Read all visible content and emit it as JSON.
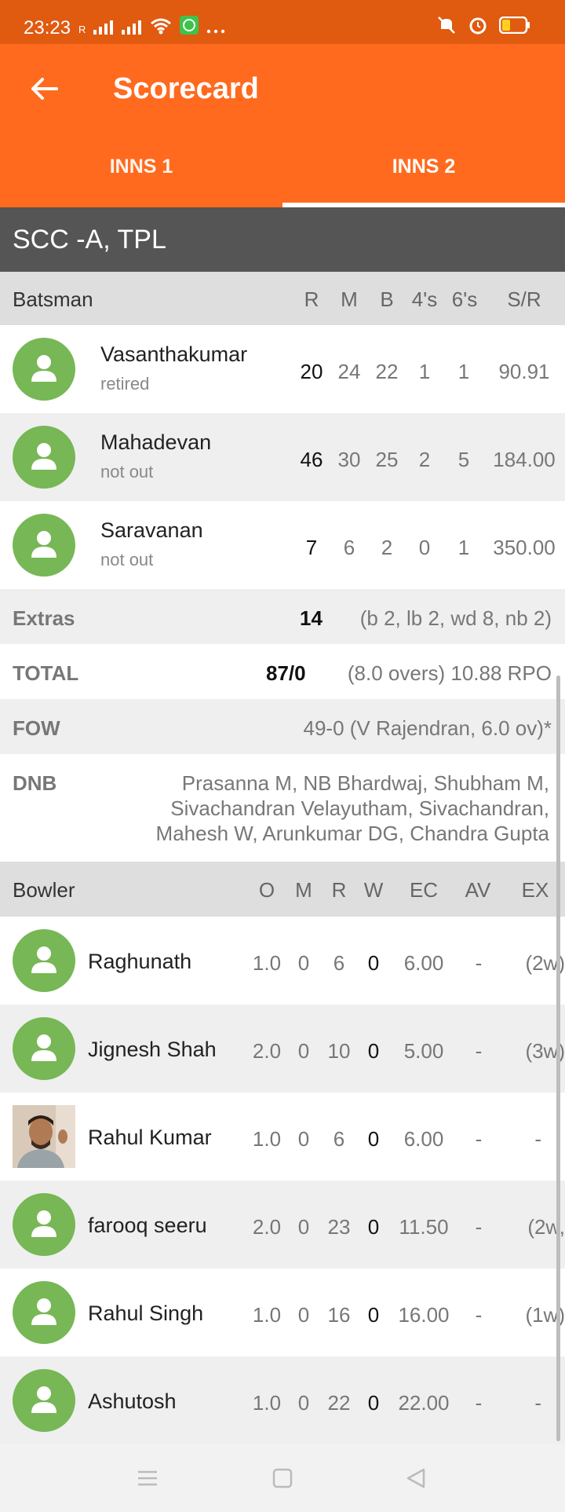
{
  "status_bar": {
    "time": "23:23",
    "signal_label": "R"
  },
  "header": {
    "title": "Scorecard",
    "back_icon": "arrow-left-icon"
  },
  "tabs": [
    {
      "label": "INNS 1"
    },
    {
      "label": "INNS 2"
    }
  ],
  "team": "SCC -A, TPL",
  "batting": {
    "columns": [
      "Batsman",
      "R",
      "M",
      "B",
      "4's",
      "6's",
      "S/R"
    ],
    "rows": [
      {
        "name": "Vasanthakumar",
        "status": "retired",
        "R": "20",
        "M": "24",
        "B": "22",
        "fours": "1",
        "sixes": "1",
        "SR": "90.91"
      },
      {
        "name": "Mahadevan",
        "status": "not out",
        "R": "46",
        "M": "30",
        "B": "25",
        "fours": "2",
        "sixes": "5",
        "SR": "184.00"
      },
      {
        "name": "Saravanan",
        "status": "not out",
        "R": "7",
        "M": "6",
        "B": "2",
        "fours": "0",
        "sixes": "1",
        "SR": "350.00"
      }
    ]
  },
  "extras": {
    "label": "Extras",
    "value": "14",
    "detail": "(b 2, lb 2, wd 8, nb 2)"
  },
  "total": {
    "label": "TOTAL",
    "value": "87/0",
    "detail": "(8.0 overs) 10.88 RPO"
  },
  "fow": {
    "label": "FOW",
    "detail": "49-0 (V Rajendran, 6.0 ov)*"
  },
  "dnb": {
    "label": "DNB",
    "lines": [
      "Prasanna M, NB Bhardwaj, Shubham M,",
      "Sivachandran Velayutham, Sivachandran,",
      "Mahesh W, Arunkumar DG, Chandra Gupta"
    ]
  },
  "bowling": {
    "columns": [
      "Bowler",
      "O",
      "M",
      "R",
      "W",
      "EC",
      "AV",
      "EX"
    ],
    "rows": [
      {
        "name": "Raghunath",
        "O": "1.0",
        "M": "0",
        "R": "6",
        "W": "0",
        "EC": "6.00",
        "AV": "-",
        "EX": "(2w)",
        "photo": false
      },
      {
        "name": "Jignesh Shah",
        "O": "2.0",
        "M": "0",
        "R": "10",
        "W": "0",
        "EC": "5.00",
        "AV": "-",
        "EX": "(3w)",
        "photo": false
      },
      {
        "name": "Rahul Kumar",
        "O": "1.0",
        "M": "0",
        "R": "6",
        "W": "0",
        "EC": "6.00",
        "AV": "-",
        "EX": "-",
        "photo": true
      },
      {
        "name": "farooq seeru",
        "O": "2.0",
        "M": "0",
        "R": "23",
        "W": "0",
        "EC": "11.50",
        "AV": "-",
        "EX": "(2w,",
        "photo": false
      },
      {
        "name": "Rahul Singh",
        "O": "1.0",
        "M": "0",
        "R": "16",
        "W": "0",
        "EC": "16.00",
        "AV": "-",
        "EX": "(1w)",
        "photo": false
      },
      {
        "name": "Ashutosh",
        "O": "1.0",
        "M": "0",
        "R": "22",
        "W": "0",
        "EC": "22.00",
        "AV": "-",
        "EX": "-",
        "photo": false
      }
    ]
  },
  "colors": {
    "appbar": "#ff6a1e",
    "statusbar": "#e05a10",
    "team_bar": "#555555",
    "avatar": "#77b755"
  }
}
